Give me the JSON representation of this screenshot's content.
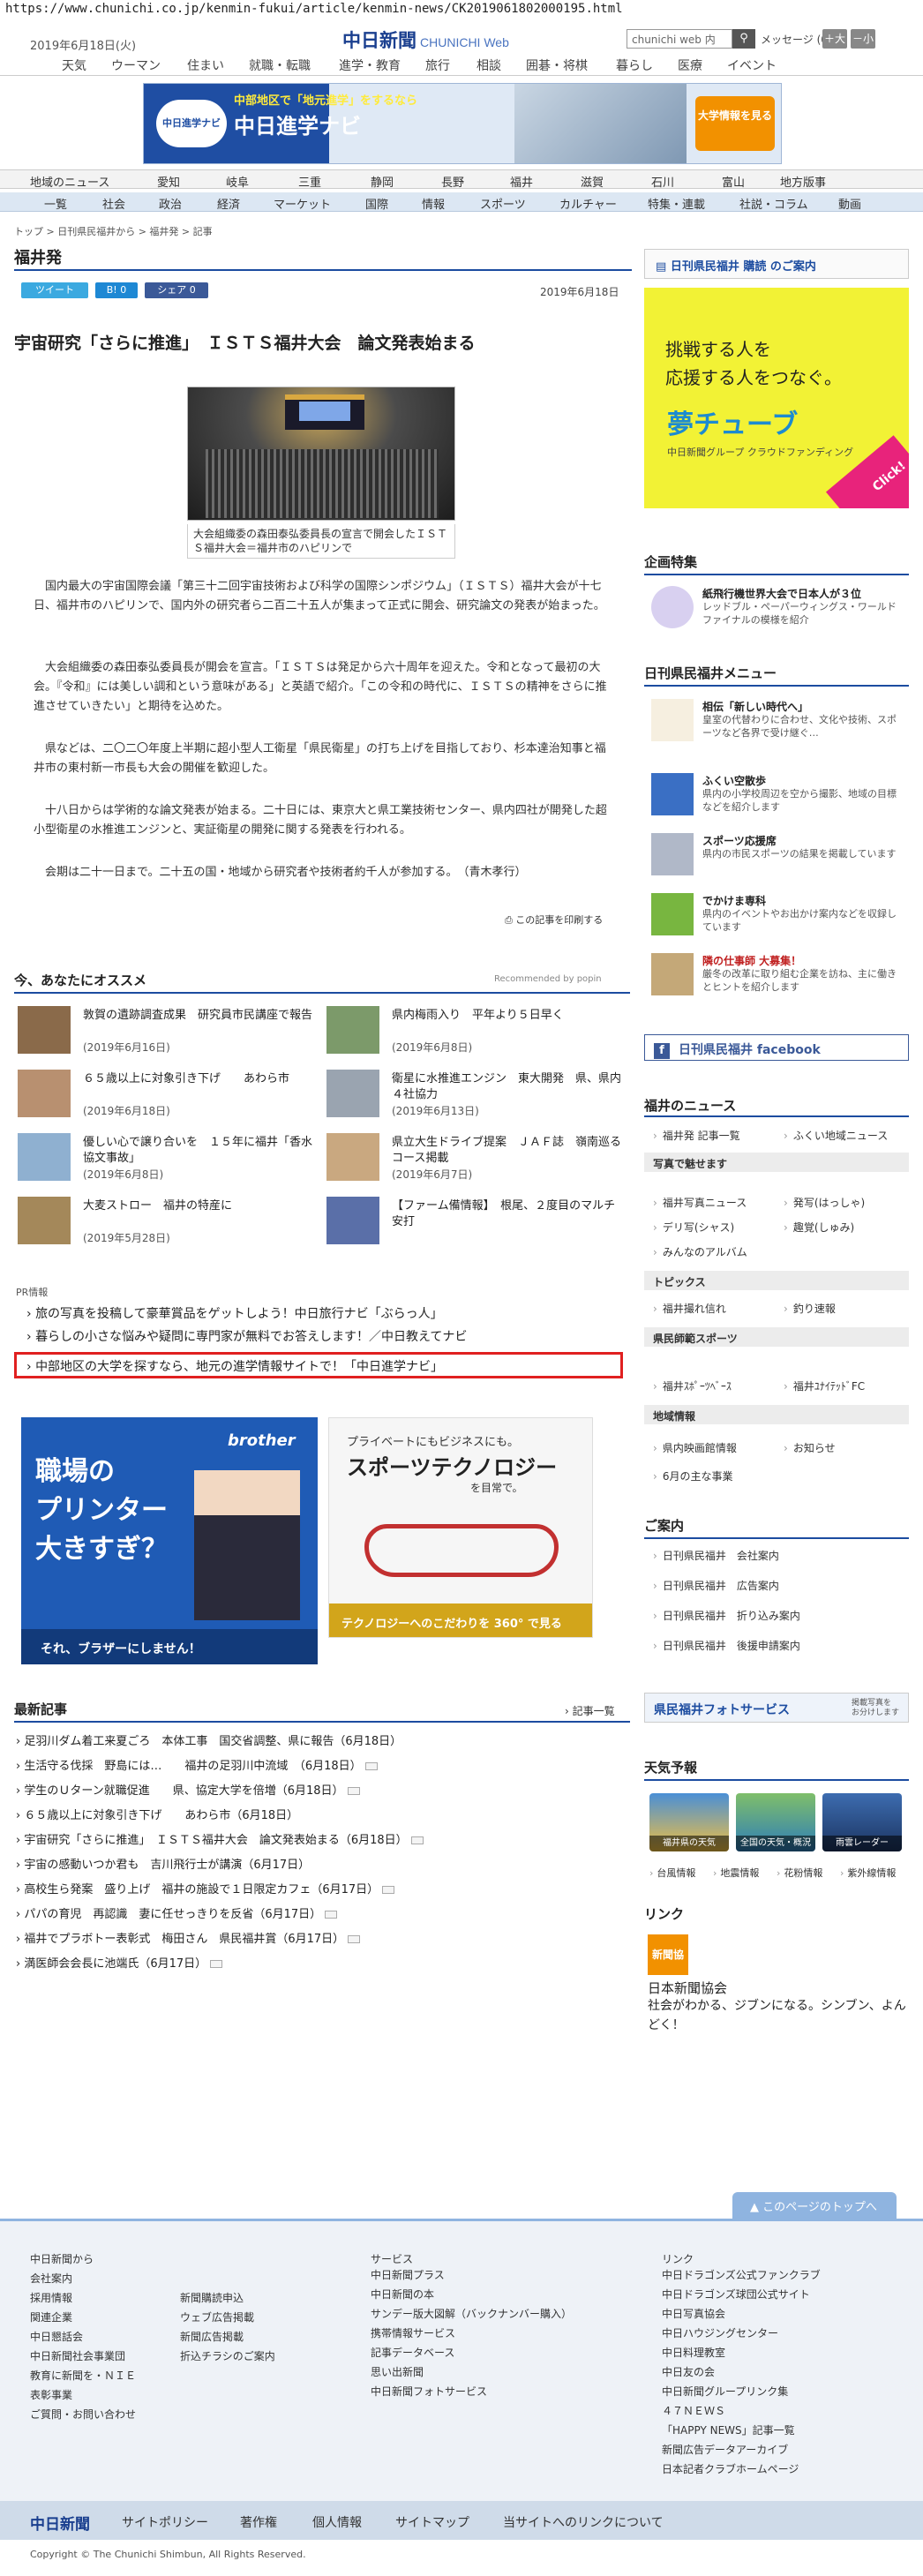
{
  "browser": {
    "url": "https://www.chunichi.co.jp/kenmin-fukui/article/kenmin-news/CK2019061802000195.html"
  },
  "header": {
    "date": "2019年6月18日(火)",
    "logo": "中日新聞",
    "logo_sub": "CHUNICHI Web",
    "search_placeholder": "chunichi web 内",
    "message": "メッセージ (0)",
    "font_large": "＋大",
    "font_small": "－小"
  },
  "topnav": [
    "天気",
    "ウーマン",
    "住まい",
    "就職・転職",
    "進学・教育",
    "旅行",
    "相談",
    "囲碁・将棋",
    "暮らし",
    "医療",
    "イベント"
  ],
  "banner": {
    "logo": "中日進学ナビ",
    "sub": "中部地区で「地元進学」をするなら",
    "title": "中日進学ナビ",
    "cta": "大学情報を見る"
  },
  "nav2": [
    "地域のニュース",
    "愛知",
    "岐阜",
    "三重",
    "静岡",
    "長野",
    "福井",
    "滋賀",
    "石川",
    "富山",
    "地方版事"
  ],
  "nav3": [
    "一覧",
    "社会",
    "政治",
    "経済",
    "マーケット",
    "国際",
    "情報",
    "スポーツ",
    "カルチャー",
    "特集・連載",
    "社説・コラム",
    "動画"
  ],
  "breadcrumb": "トップ > 日刊県民福井から > 福井発 > 記事",
  "section": "福井発",
  "share": {
    "tweet": "ツイート",
    "hatena": "B! 0",
    "fb": "シェア 0"
  },
  "article": {
    "date": "2019年6月18日",
    "headline": "宇宙研究「さらに推進」　ＩＳＴＳ福井大会　論文発表始まる",
    "caption": "大会組織委の森田泰弘委員長の宣言で開会したＩＳＴＳ福井大会＝福井市のハピリンで",
    "paragraphs": [
      "国内最大の宇宙国際会議「第三十二回宇宙技術および科学の国際シンポジウム」（ＩＳＴＳ）福井大会が十七日、福井市のハピリンで、国内外の研究者ら二百二十五人が集まって正式に開会、研究論文の発表が始まった。",
      "大会組織委の森田泰弘委員長が開会を宣言。「ＩＳＴＳは発足から六十周年を迎えた。令和となって最初の大会。『令和』には美しい調和という意味がある」と英語で紹介。「この令和の時代に、ＩＳＴＳの精神をさらに推進させていきたい」と期待を込めた。",
      "県などは、二〇二〇年度上半期に超小型人工衛星「県民衛星」の打ち上げを目指しており、杉本達治知事と福井市の東村新一市長も大会の開催を歓迎した。",
      "十八日からは学術的な論文発表が始まる。二十日には、東京大と県工業技術センター、県内四社が開発した超小型衛星の水推進エンジンと、実証衛星の開発に関する発表を行われる。",
      "会期は二十一日まで。二十五の国・地域から研究者や技術者約千人が参加する。　（青木孝行）"
    ],
    "print": "この記事を印刷する"
  },
  "recommend": {
    "title": "今、あなたにオススメ",
    "by": "Recommended by popin",
    "items": [
      {
        "title": "敦賀の遺跡調査成果　研究員市民講座で報告",
        "date": "(2019年6月16日)"
      },
      {
        "title": "県内梅雨入り　平年より５日早く",
        "date": "(2019年6月8日)"
      },
      {
        "title": "６５歳以上に対象引き下げ　　あわら市",
        "date": "(2019年6月18日)"
      },
      {
        "title": "衛星に水推進エンジン　東大開発　県、県内４社協力",
        "date": "(2019年6月13日)"
      },
      {
        "title": "優しい心で譲り合いを　１５年に福井「香水協文事故」",
        "date": "(2019年6月8日)"
      },
      {
        "title": "県立大生ドライブ提案　ＪＡＦ誌　嶺南巡るコース掲載",
        "date": "(2019年6月7日)"
      },
      {
        "title": "大麦ストロー　福井の特産に",
        "date": "(2019年5月28日)"
      },
      {
        "title": "【ファーム備情報】　根尾、２度目のマルチ安打",
        "date": ""
      }
    ]
  },
  "pr": {
    "label": "PR情報",
    "links": [
      "旅の写真を投稿して豪華賞品をゲットしよう！中日旅行ナビ「ぶらっ人」",
      "暮らしの小さな悩みや疑問に専門家が無料でお答えします！／中日教えてナビ",
      "中部地区の大学を探すなら、地元の進学情報サイトで！「中日進学ナビ」"
    ]
  },
  "ads": {
    "brother": {
      "brand": "brother",
      "big": "職場の\nプリンター\n大きすぎ？",
      "foot": "それ、ブラザーにしません！"
    },
    "sport": {
      "small": "プライベートにもビジネスにも。",
      "title": "スポーツテクノロジー",
      "sub": "を目常で。",
      "bottom": "テクノロジーへのこだわりを 360° で見る"
    }
  },
  "latest": {
    "title": "最新記事",
    "more": "記事一覧",
    "items": [
      "足羽川ダム着工来夏ごろ　本体工事　国交省調整、県に報告（6月18日）",
      "生活守る伐採　野島には…　　福井の足羽川中流域　（6月18日）",
      "学生のＵターン就職促進　　県、協定大学を倍増（6月18日）",
      "６５歳以上に対象引き下げ　　あわら市（6月18日）",
      "宇宙研究「さらに推進」　ＩＳＴＳ福井大会　論文発表始まる（6月18日）",
      "宇宙の感動いつか君も　吉川飛行士が講演（6月17日）",
      "高校生ら発案　盛り上げ　福井の施設で１日限定カフェ（6月17日）",
      "パパの育児　再認識　妻に任せっきりを反省（6月17日）",
      "福井でプラボトー表彰式　梅田さん　県民福井賞（6月17日）",
      "満医師会会長に池端氏（6月17日）"
    ]
  },
  "sidebar": {
    "top_box": "日刊県民福井 購読 のご案内",
    "ad": {
      "line1": "挑戦する人を",
      "line2": "応援する人をつなぐ。",
      "brand": "夢チューブ",
      "sub": "中日新聞グループ クラウドファンディング",
      "click": "Click!"
    },
    "kikaku_title": "企画特集",
    "kikaku_item": {
      "title": "紙飛行機世界大会で日本人が３位",
      "desc": "レッドブル・ペーパーウィングス・ワールドファイナルの模様を紹介"
    },
    "menu_title": "日刊県民福井メニュー",
    "menu_items": [
      {
        "title": "相伝「新しい時代へ」",
        "desc": "皇室の代替わりに合わせ、文化や技術、スポーツなど各界で受け継ぐ…"
      },
      {
        "title": "ふくい空散歩",
        "desc": "県内の小学校周辺を空から撮影、地域の目標などを紹介します"
      },
      {
        "title": "スポーツ応援席",
        "desc": "県内の市民スポーツの結果を掲載しています"
      },
      {
        "title": "でかけま専科",
        "desc": "県内のイベントやお出かけ案内などを収録しています"
      },
      {
        "title": "隣の仕事師 大募集！",
        "desc": "厳冬の改革に取り組む企業を訪ね、主に働きとヒントを紹介します"
      }
    ],
    "facebook": "日刊県民福井 facebook",
    "news_title": "福井のニュース",
    "news_links": [
      "福井発 記事一覧",
      "ふくい地域ニュース"
    ],
    "sub1": "写真で魅せます",
    "sub1_links": [
      "福井写真ニュース",
      "発写(はっしゃ)",
      "デリ写(シャス)",
      "趣覚(しゅみ)",
      "みんなのアルバム"
    ],
    "sub2": "トピックス",
    "sub2_links": [
      "福井撮れ信れ",
      "釣り速報"
    ],
    "sub3": "県民師範スポーツ",
    "sub3_links": [
      "福井ｽﾎﾟｰﾂﾍﾞｰｽ",
      "福井ﾕﾅｲﾃｯﾄﾞFC"
    ],
    "sub4": "地域情報",
    "sub4_links": [
      "県内映画館情報",
      "お知らせ",
      "6月の主な事業"
    ],
    "guide_title": "ご案内",
    "guide_links": [
      "日刊県民福井　会社案内",
      "日刊県民福井　広告案内",
      "日刊県民福井　折り込み案内",
      "日刊県民福井　後援申請案内"
    ],
    "photo_service": "県民福井フォトサービス",
    "photo_service_note": "掲載写真を\nお分けします",
    "weather_title": "天気予報",
    "weather": [
      "福井県の天気",
      "全国の天気・概況",
      "雨雲レーダー"
    ],
    "weather_links": [
      "台風情報",
      "地震情報",
      "花粉情報",
      "紫外線情報"
    ],
    "link_title": "リンク",
    "jna_logo": "新聞協会",
    "jna_name": "日本新聞協会",
    "jna_desc": "社会がわかる、ジブンになる。シンブン、よんどく！"
  },
  "pagetop": "このページのトップへ",
  "footer": {
    "col1_title": "中日新聞から",
    "col1": [
      "会社案内",
      "採用情報",
      "関連企業",
      "中日懇話会",
      "中日新聞社会事業団",
      "教育に新聞を・ＮＩＥ",
      "表彰事業",
      "ご質問・お問い合わせ"
    ],
    "col1b": [
      "新聞購読申込",
      "ウェブ広告掲載",
      "新聞広告掲載",
      "折込チラシのご案内"
    ],
    "col2_title": "サービス",
    "col2": [
      "中日新聞プラス",
      "中日新聞の本",
      "サンデー版大図解（バックナンバー購入）",
      "携帯情報サービス",
      "記事データベース",
      "思い出新聞",
      "中日新聞フォトサービス"
    ],
    "col3_title": "リンク",
    "col3": [
      "中日ドラゴンズ公式ファンクラブ",
      "中日ドラゴンズ球団公式サイト",
      "中日写真協会",
      "中日ハウジングセンター",
      "中日料理教室",
      "中日友の会",
      "中日新聞グループリンク集",
      "４７ＮＥＷＳ",
      "「HAPPY NEWS」記事一覧",
      "新聞広告データアーカイブ",
      "日本記者クラブホームページ"
    ],
    "bar_logo": "中日新聞",
    "bar_links": [
      "サイトポリシー",
      "著作権",
      "個人情報",
      "サイトマップ",
      "当サイトへのリンクについて"
    ],
    "copyright": "Copyright © The Chunichi Shimbun, All Rights Reserved."
  }
}
